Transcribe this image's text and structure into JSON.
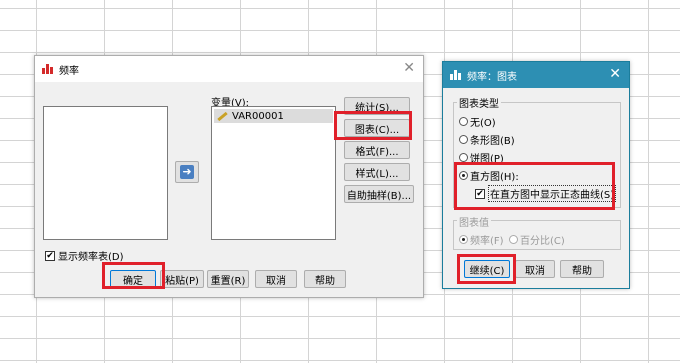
{
  "frequencies_dialog": {
    "title": "频率",
    "variables_label": "变量(V):",
    "variables": [
      {
        "name": "VAR00001"
      }
    ],
    "side_buttons": [
      {
        "label": "统计(S)..."
      },
      {
        "label": "图表(C)..."
      },
      {
        "label": "格式(F)..."
      },
      {
        "label": "样式(L)..."
      },
      {
        "label": "自助抽样(B)..."
      }
    ],
    "display_tables_label": "显示频率表(D)",
    "display_tables_checked": true,
    "bottom_buttons": {
      "ok": "确定",
      "paste": "粘贴(P)",
      "reset": "重置(R)",
      "cancel": "取消",
      "help": "帮助"
    }
  },
  "charts_dialog": {
    "title": "频率：图表",
    "chart_type_legend": "图表类型",
    "chart_types": [
      {
        "label": "无(O)",
        "selected": false
      },
      {
        "label": "条形图(B)",
        "selected": false
      },
      {
        "label": "饼图(P)",
        "selected": false
      },
      {
        "label": "直方图(H):",
        "selected": true
      }
    ],
    "normal_curve_label": "在直方图中显示正态曲线(S)",
    "normal_curve_checked": true,
    "chart_values_legend": "图表值",
    "chart_values": [
      {
        "label": "频率(F)",
        "selected": true
      },
      {
        "label": "百分比(C)",
        "selected": false
      }
    ],
    "buttons": {
      "continue": "继续(C)",
      "cancel": "取消",
      "help": "帮助"
    }
  },
  "colors": {
    "highlight": "#e0202a",
    "title_bar_active": "#2d8fb3"
  },
  "icons": [
    "spss-app-icon",
    "close-icon",
    "move-right-arrow-icon",
    "ruler-pencil-icon",
    "checkmark-icon"
  ]
}
